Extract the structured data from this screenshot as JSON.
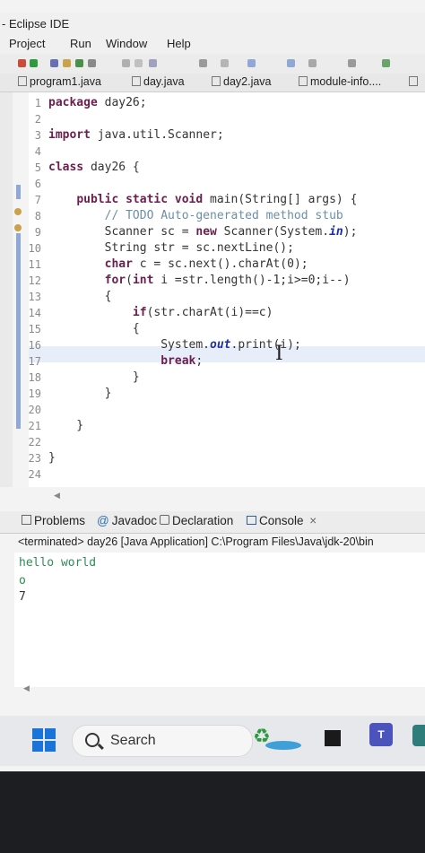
{
  "window": {
    "title": "- Eclipse IDE"
  },
  "menu": {
    "items": [
      "Project",
      "Run",
      "Window",
      "Help"
    ]
  },
  "tabs": [
    "program1.java",
    "day.java",
    "day2.java",
    "module-info...."
  ],
  "editor": {
    "line_numbers": [
      "1",
      "2",
      "3",
      "4",
      "5",
      "6",
      "7",
      "8",
      "9",
      "10",
      "11",
      "12",
      "13",
      "14",
      "15",
      "16",
      "17",
      "18",
      "19",
      "20",
      "21",
      "22",
      "23",
      "24"
    ],
    "l1_kw": "package",
    "l1_rest": " day26;",
    "l3_kw": "import",
    "l3_rest": " java.util.Scanner;",
    "l5_kw": "class",
    "l5_rest": " day26 {",
    "l7_pre": "    ",
    "l7_kw": "public static void",
    "l7_rest": " main(String[] args) {",
    "l8_comment": "        // TODO Auto-generated method stub",
    "l9_a": "        Scanner sc = ",
    "l9_kw": "new",
    "l9_b": " Scanner(System.",
    "l9_field": "in",
    "l9_c": ");",
    "l10": "        String str = sc.nextLine();",
    "l11_pre": "        ",
    "l11_kw": "char",
    "l11_rest": " c = sc.next().charAt(0);",
    "l12_pre": "        ",
    "l12_kw": "for",
    "l12_mid": "(",
    "l12_kw2": "int",
    "l12_rest": " i =str.length()-1;i>=0;i--)",
    "l13": "        {",
    "l14_pre": "            ",
    "l14_kw": "if",
    "l14_rest": "(str.charAt(i)==c)",
    "l15": "            {",
    "l16_a": "                System.",
    "l16_field": "out",
    "l16_b": ".print(i);",
    "l17_pre": "                ",
    "l17_kw": "break",
    "l17_rest": ";",
    "l18": "            }",
    "l19": "        }",
    "l21": "    }",
    "l23": "}"
  },
  "console": {
    "tabs": [
      "Problems",
      "Javadoc",
      "Declaration",
      "Console"
    ],
    "close_glyph": "×",
    "status": "<terminated> day26 [Java Application] C:\\Program Files\\Java\\jdk-20\\bin",
    "output": [
      "hello world",
      "o",
      "7"
    ]
  },
  "taskbar": {
    "search_label": "Search"
  },
  "colors": {
    "keyword": "#6b1f4e",
    "comment": "#6b8fa6",
    "console_output": "#2e8b57",
    "windows_blue": "#1a73d8"
  }
}
